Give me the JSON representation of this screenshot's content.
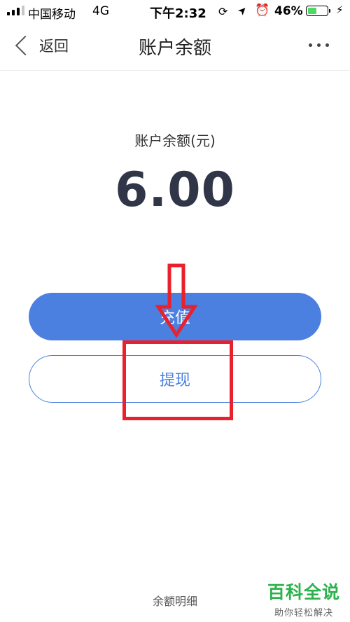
{
  "status_bar": {
    "carrier": "中国移动",
    "network": "4G",
    "time": "下午2:32",
    "battery_percent": "46%",
    "battery_level": 0.46,
    "battery_color": "#4cd964",
    "icons": [
      "signal-icon",
      "rotation-lock-icon",
      "location-icon",
      "alarm-icon",
      "battery-icon",
      "charging-icon"
    ]
  },
  "nav": {
    "back_label": "返回",
    "title": "账户余额"
  },
  "balance": {
    "label": "账户余额(元)",
    "amount": "6.00"
  },
  "actions": {
    "recharge_label": "充值",
    "withdraw_label": "提现"
  },
  "footer": {
    "detail_label": "余额明细"
  },
  "watermark": {
    "brand": "百科全说",
    "slogan": "助你轻松解决"
  },
  "colors": {
    "accent": "#4b7fe0",
    "annotation": "#e8212c",
    "watermark": "#2bb24c"
  }
}
